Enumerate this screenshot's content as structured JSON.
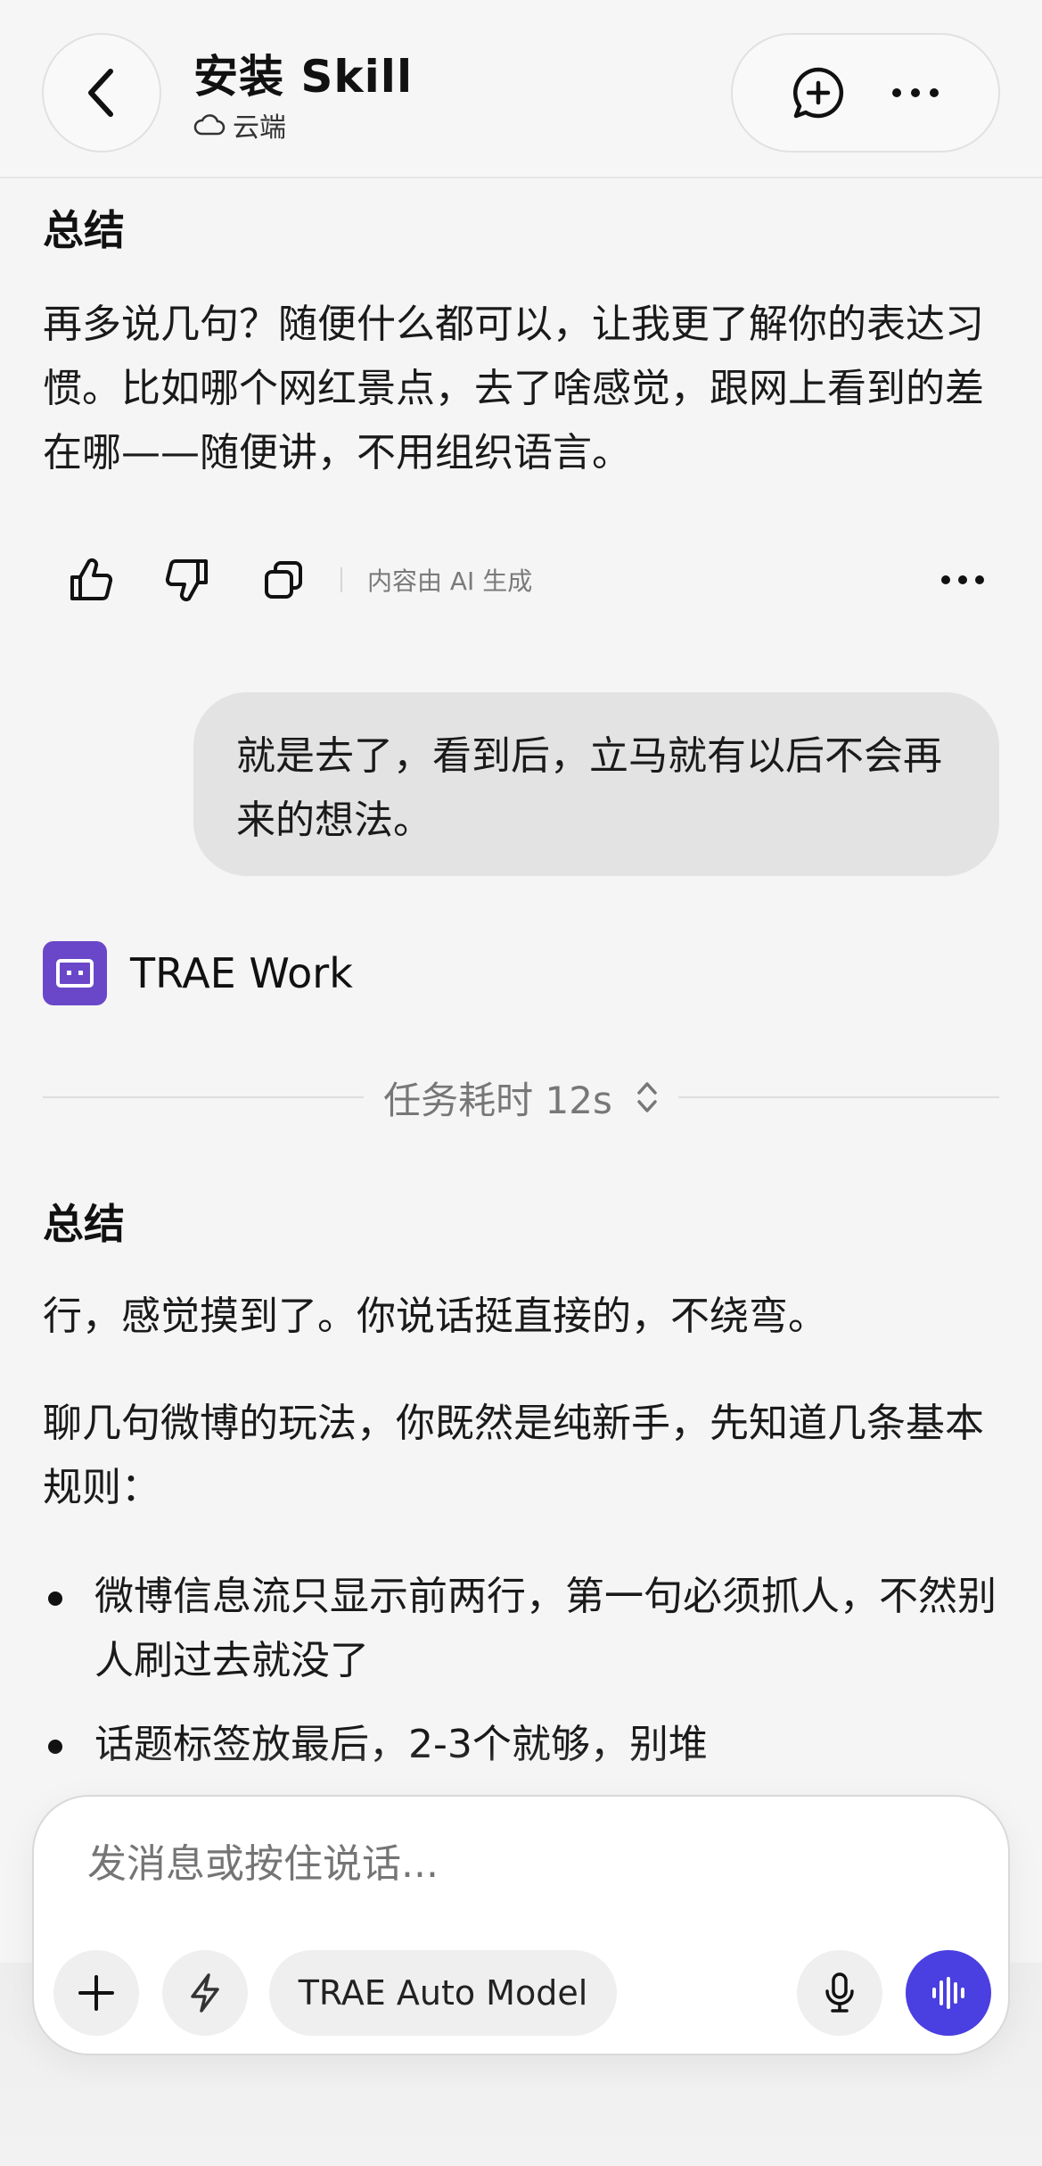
{
  "header": {
    "title": "安装 Skill",
    "subtitle": "云端"
  },
  "message1": {
    "heading": "总结",
    "text": "再多说几句？随便什么都可以，让我更了解你的表达习惯。比如哪个网红景点，去了啥感觉，跟网上看到的差在哪——随便讲，不用组织语言。",
    "ai_note": "内容由 AI 生成"
  },
  "user_message": {
    "text": "就是去了，看到后，立马就有以后不会再来的想法。"
  },
  "bot": {
    "name": "TRAE Work",
    "task_time": "任务耗时 12s"
  },
  "message2": {
    "heading": "总结",
    "para1": "行，感觉摸到了。你说话挺直接的，不绕弯。",
    "para2": "聊几句微博的玩法，你既然是纯新手，先知道几条基本规则：",
    "bullets": [
      "微博信息流只显示前两行，第一句必须抓人，不然别人刷过去就没了",
      "话题标签放最后，2-3个就够，别堆"
    ]
  },
  "composer": {
    "placeholder": "发消息或按住说话...",
    "model_label": "TRAE Auto Model"
  },
  "colors": {
    "accent": "#4a3fe0",
    "bot_avatar": "#6a47c9"
  }
}
